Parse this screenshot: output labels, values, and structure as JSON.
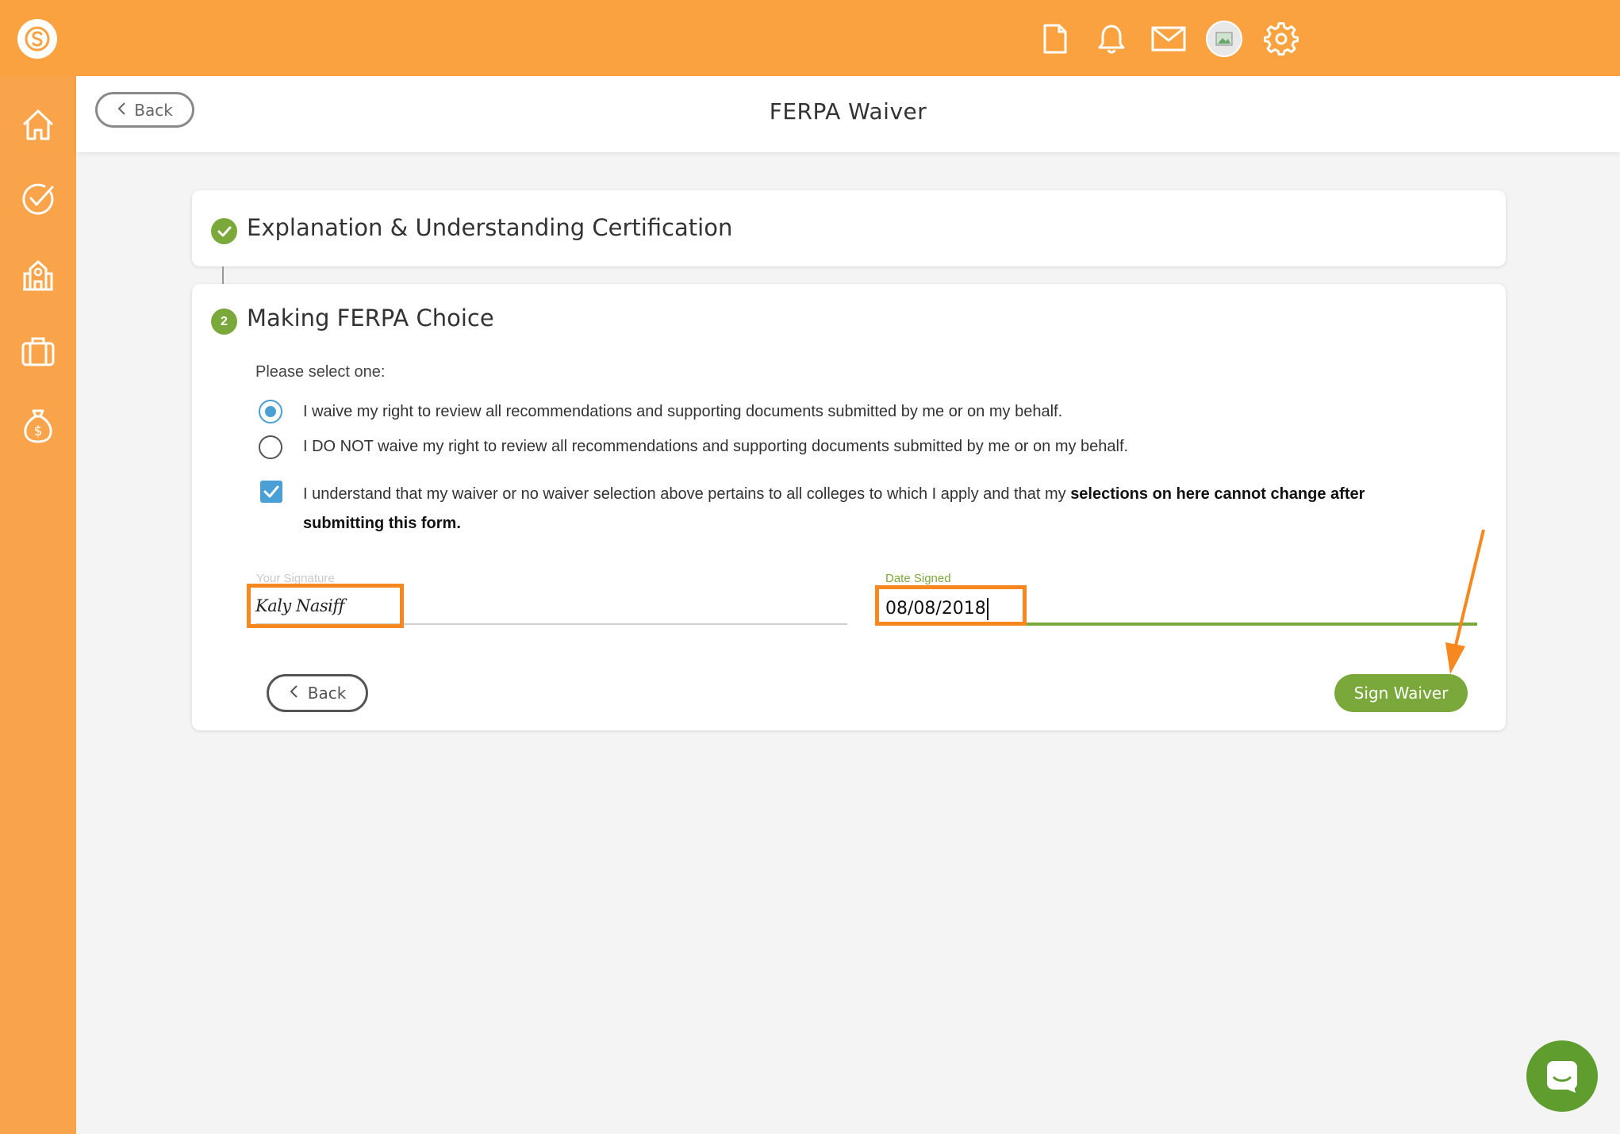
{
  "header": {
    "title": "FERPA Waiver",
    "back_label": "Back"
  },
  "colors": {
    "brand": "#f9a23f",
    "sidebar": "#f9a44a",
    "accent_green": "#7aa83b",
    "radio_blue": "#4a9fd4",
    "highlight_orange": "#f7871f"
  },
  "topbar": {
    "icons": [
      "document-icon",
      "bell-icon",
      "mail-icon",
      "avatar",
      "gear-icon"
    ]
  },
  "sidebar": {
    "icons": [
      "home-icon",
      "checkmark-circle-icon",
      "college-icon",
      "briefcase-icon",
      "money-bag-icon"
    ]
  },
  "steps": [
    {
      "title": "Explanation & Understanding Certification",
      "status": "complete"
    },
    {
      "number": "2",
      "title": "Making FERPA Choice",
      "status": "active"
    }
  ],
  "form": {
    "prompt": "Please select one:",
    "options": [
      {
        "label": "I waive my right to review all recommendations and supporting documents submitted by me or on my behalf.",
        "selected": true
      },
      {
        "label": "I DO NOT waive my right to review all recommendations and supporting documents submitted by me or on my behalf.",
        "selected": false
      }
    ],
    "certification": {
      "checked": true,
      "text": "I understand that my waiver or no waiver selection above pertains to all colleges to which I apply and that my ",
      "bold_text": "selections on here cannot change after submitting this form."
    },
    "signature_label": "Your Signature",
    "signature_value": "Kaly Nasiff",
    "date_label": "Date Signed",
    "date_value": "08/08/2018",
    "back_label": "Back",
    "submit_label": "Sign Waiver"
  }
}
